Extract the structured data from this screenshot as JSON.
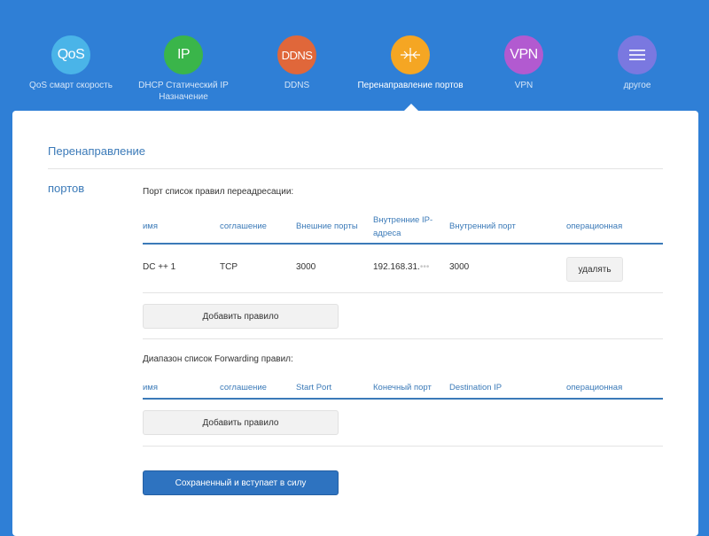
{
  "nav": {
    "items": [
      {
        "icon_text": "QoS",
        "label": "QoS смарт скорость",
        "color": "#4ab4e8",
        "icon": "qos-icon"
      },
      {
        "icon_text": "IP",
        "label": "DHCP Статический IP Назначение",
        "color": "#3ab54a",
        "icon": "ip-icon"
      },
      {
        "icon_text": "DDNS",
        "label": "DDNS",
        "color": "#e0673a",
        "icon": "ddns-icon"
      },
      {
        "icon_text": "",
        "label": "Перенаправление портов",
        "color": "#f5a623",
        "icon": "port-forward-icon"
      },
      {
        "icon_text": "VPN",
        "label": "VPN",
        "color": "#b25ad0",
        "icon": "vpn-icon"
      },
      {
        "icon_text": "",
        "label": "другое",
        "color": "#7a78e0",
        "icon": "menu-icon"
      }
    ]
  },
  "section": {
    "title_line1": "Перенаправление",
    "title_line2": "портов"
  },
  "rules": {
    "caption": "Порт список правил переадресации:",
    "headers": [
      "имя",
      "соглашение",
      "Внешние порты",
      "Внутренние IP-адреса",
      "Внутренний порт",
      "операционная"
    ],
    "rows": [
      {
        "name": "DC ++ 1",
        "protocol": "TCP",
        "external_port": "3000",
        "internal_ip": "192.168.31.",
        "internal_ip_tail": "•••",
        "internal_port": "3000",
        "action": "удалять"
      }
    ],
    "add_label": "Добавить правило"
  },
  "range_rules": {
    "caption": "Диапазон список Forwarding правил:",
    "headers": [
      "имя",
      "соглашение",
      "Start Port",
      "Конечный порт",
      "Destination IP",
      "операционная"
    ],
    "add_label": "Добавить правило"
  },
  "save_label": "Сохраненный и вступает в силу",
  "colors": {
    "accent": "#3b7ab8",
    "background": "#2f7fd6",
    "save": "#2e73c0"
  }
}
